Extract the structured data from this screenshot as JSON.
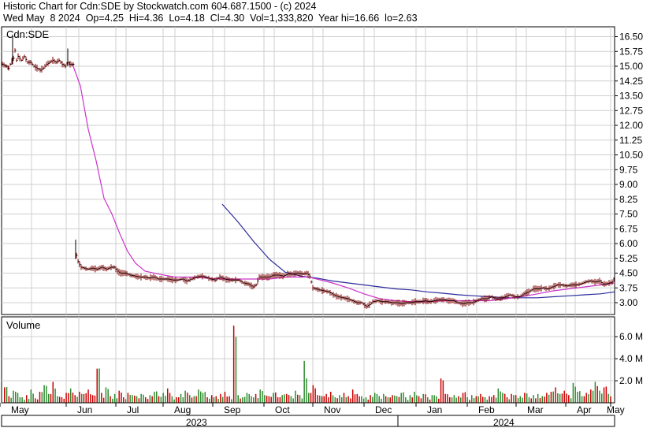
{
  "header": {
    "line1": "Historic Chart for Cdn:SDE by Stockwatch.com 604.687.1500 - (c) 2024",
    "line2": "Wed May  8 2024  Op=4.25  Hi=4.36  Lo=4.18  Cl=4.30  Vol=1,333,820  Year hi=16.66  lo=2.63"
  },
  "chart_data": [
    {
      "type": "line",
      "label": "Cdn:SDE",
      "grid": true,
      "x_axis": {
        "months": [
          "May",
          "Jun",
          "Jul",
          "Aug",
          "Sep",
          "Oct",
          "Nov",
          "Dec",
          "Jan",
          "Feb",
          "Mar",
          "Apr",
          "May"
        ],
        "years": [
          "2023",
          "2024"
        ]
      },
      "y_axis": {
        "ticks": [
          "16.50",
          "15.75",
          "15.00",
          "14.25",
          "13.50",
          "12.75",
          "12.00",
          "11.25",
          "10.50",
          "9.75",
          "9.00",
          "8.25",
          "7.50",
          "6.75",
          "6.00",
          "5.25",
          "4.50",
          "3.75",
          "3.00"
        ],
        "range": [
          2.4,
          17.0
        ]
      },
      "price_points": [
        [
          0,
          15.1
        ],
        [
          5,
          15.0
        ],
        [
          8,
          14.9
        ],
        [
          10,
          15.1
        ],
        [
          14,
          15.4
        ],
        [
          16,
          15.8
        ],
        [
          18,
          15.3
        ],
        [
          20,
          15.5
        ],
        [
          24,
          15.3
        ],
        [
          28,
          15.5
        ],
        [
          32,
          15.2
        ],
        [
          36,
          15.2
        ],
        [
          40,
          15.0
        ],
        [
          44,
          14.9
        ],
        [
          48,
          14.8
        ],
        [
          52,
          14.9
        ],
        [
          56,
          15.1
        ],
        [
          60,
          15.2
        ],
        [
          64,
          15.3
        ],
        [
          68,
          15.2
        ],
        [
          72,
          15.3
        ],
        [
          76,
          15.1
        ],
        [
          80,
          15.0
        ],
        [
          83,
          15.2
        ],
        [
          86,
          15.1
        ],
        [
          90,
          15.1
        ],
        [
          94,
          5.4
        ],
        [
          96,
          5.1
        ],
        [
          100,
          4.8
        ],
        [
          104,
          4.75
        ],
        [
          108,
          4.7
        ],
        [
          114,
          4.75
        ],
        [
          120,
          4.7
        ],
        [
          126,
          4.8
        ],
        [
          132,
          4.7
        ],
        [
          138,
          4.8
        ],
        [
          142,
          4.8
        ],
        [
          146,
          4.6
        ],
        [
          150,
          4.5
        ],
        [
          156,
          4.5
        ],
        [
          162,
          4.4
        ],
        [
          168,
          4.35
        ],
        [
          174,
          4.3
        ],
        [
          180,
          4.3
        ],
        [
          186,
          4.25
        ],
        [
          192,
          4.3
        ],
        [
          198,
          4.2
        ],
        [
          204,
          4.2
        ],
        [
          210,
          4.2
        ],
        [
          216,
          4.15
        ],
        [
          222,
          4.15
        ],
        [
          228,
          4.2
        ],
        [
          234,
          4.1
        ],
        [
          240,
          4.2
        ],
        [
          246,
          4.3
        ],
        [
          252,
          4.35
        ],
        [
          258,
          4.3
        ],
        [
          264,
          4.2
        ],
        [
          270,
          4.15
        ],
        [
          276,
          4.3
        ],
        [
          282,
          4.2
        ],
        [
          288,
          4.15
        ],
        [
          294,
          4.15
        ],
        [
          300,
          4.15
        ],
        [
          306,
          4.0
        ],
        [
          312,
          3.95
        ],
        [
          318,
          3.8
        ],
        [
          322,
          3.9
        ],
        [
          326,
          4.3
        ],
        [
          332,
          4.3
        ],
        [
          338,
          4.3
        ],
        [
          344,
          4.4
        ],
        [
          350,
          4.4
        ],
        [
          356,
          4.35
        ],
        [
          362,
          4.45
        ],
        [
          368,
          4.45
        ],
        [
          374,
          4.5
        ],
        [
          380,
          4.45
        ],
        [
          386,
          4.5
        ],
        [
          390,
          4.35
        ],
        [
          394,
          3.75
        ],
        [
          398,
          3.7
        ],
        [
          402,
          3.65
        ],
        [
          408,
          3.6
        ],
        [
          414,
          3.55
        ],
        [
          420,
          3.4
        ],
        [
          426,
          3.3
        ],
        [
          432,
          3.25
        ],
        [
          438,
          3.2
        ],
        [
          444,
          3.1
        ],
        [
          450,
          3.0
        ],
        [
          456,
          3.0
        ],
        [
          462,
          2.8
        ],
        [
          466,
          2.9
        ],
        [
          470,
          3.05
        ],
        [
          476,
          3.1
        ],
        [
          482,
          3.05
        ],
        [
          488,
          3.05
        ],
        [
          494,
          3.0
        ],
        [
          500,
          3.0
        ],
        [
          506,
          2.95
        ],
        [
          512,
          3.0
        ],
        [
          518,
          3.0
        ],
        [
          524,
          3.05
        ],
        [
          530,
          3.05
        ],
        [
          536,
          3.1
        ],
        [
          542,
          3.05
        ],
        [
          548,
          3.1
        ],
        [
          554,
          3.15
        ],
        [
          560,
          3.15
        ],
        [
          566,
          3.1
        ],
        [
          572,
          3.1
        ],
        [
          578,
          3.0
        ],
        [
          584,
          2.95
        ],
        [
          590,
          3.0
        ],
        [
          596,
          3.0
        ],
        [
          602,
          3.1
        ],
        [
          608,
          3.2
        ],
        [
          614,
          3.2
        ],
        [
          620,
          3.3
        ],
        [
          626,
          3.2
        ],
        [
          632,
          3.2
        ],
        [
          638,
          3.3
        ],
        [
          644,
          3.4
        ],
        [
          650,
          3.3
        ],
        [
          656,
          3.3
        ],
        [
          662,
          3.45
        ],
        [
          668,
          3.55
        ],
        [
          674,
          3.7
        ],
        [
          680,
          3.7
        ],
        [
          686,
          3.75
        ],
        [
          692,
          3.7
        ],
        [
          698,
          3.8
        ],
        [
          704,
          3.9
        ],
        [
          710,
          3.9
        ],
        [
          716,
          3.85
        ],
        [
          722,
          3.9
        ],
        [
          728,
          3.9
        ],
        [
          734,
          3.95
        ],
        [
          740,
          4.05
        ],
        [
          746,
          4.1
        ],
        [
          752,
          4.05
        ],
        [
          758,
          4.1
        ],
        [
          762,
          3.95
        ],
        [
          766,
          3.95
        ],
        [
          770,
          4.0
        ],
        [
          774,
          4.05
        ],
        [
          778,
          4.3
        ]
      ],
      "ma_short_points": [
        [
          90,
          15.1
        ],
        [
          100,
          14.0
        ],
        [
          110,
          11.8
        ],
        [
          120,
          10.2
        ],
        [
          130,
          8.3
        ],
        [
          140,
          7.5
        ],
        [
          150,
          6.5
        ],
        [
          160,
          5.6
        ],
        [
          170,
          5.0
        ],
        [
          182,
          4.6
        ],
        [
          200,
          4.45
        ],
        [
          220,
          4.3
        ],
        [
          240,
          4.3
        ],
        [
          260,
          4.25
        ],
        [
          280,
          4.2
        ],
        [
          300,
          4.2
        ],
        [
          320,
          4.2
        ],
        [
          340,
          4.2
        ],
        [
          360,
          4.3
        ],
        [
          380,
          4.3
        ],
        [
          390,
          4.3
        ],
        [
          400,
          4.2
        ],
        [
          420,
          4.0
        ],
        [
          440,
          3.75
        ],
        [
          460,
          3.45
        ],
        [
          480,
          3.2
        ],
        [
          500,
          3.1
        ],
        [
          520,
          3.05
        ],
        [
          540,
          3.05
        ],
        [
          560,
          3.1
        ],
        [
          580,
          3.1
        ],
        [
          600,
          3.1
        ],
        [
          620,
          3.1
        ],
        [
          640,
          3.2
        ],
        [
          660,
          3.3
        ],
        [
          680,
          3.45
        ],
        [
          700,
          3.6
        ],
        [
          720,
          3.7
        ],
        [
          740,
          3.8
        ],
        [
          760,
          3.9
        ],
        [
          778,
          4.0
        ]
      ],
      "ma_long_points": [
        [
          280,
          8.0
        ],
        [
          300,
          7.1
        ],
        [
          320,
          6.1
        ],
        [
          340,
          5.2
        ],
        [
          360,
          4.55
        ],
        [
          380,
          4.35
        ],
        [
          400,
          4.25
        ],
        [
          420,
          4.1
        ],
        [
          440,
          4.0
        ],
        [
          460,
          3.9
        ],
        [
          480,
          3.8
        ],
        [
          500,
          3.7
        ],
        [
          520,
          3.65
        ],
        [
          540,
          3.55
        ],
        [
          560,
          3.48
        ],
        [
          580,
          3.4
        ],
        [
          600,
          3.35
        ],
        [
          620,
          3.3
        ],
        [
          640,
          3.25
        ],
        [
          660,
          3.25
        ],
        [
          680,
          3.25
        ],
        [
          700,
          3.3
        ],
        [
          720,
          3.35
        ],
        [
          740,
          3.4
        ],
        [
          760,
          3.45
        ],
        [
          778,
          3.55
        ]
      ],
      "price_color": "#800000",
      "ma_short_color": "#cc33cc",
      "ma_long_color": "#2b2b9c"
    },
    {
      "type": "bar",
      "label": "Volume",
      "y_axis": {
        "ticks": [
          "6.0 M",
          "4.0 M",
          "2.0 M"
        ],
        "range": [
          0,
          7.8
        ]
      },
      "volumes_millions": [
        1.4,
        0.6,
        1.1,
        0.9,
        0.5,
        0.7,
        1.2,
        0.4,
        1.0,
        1.6,
        0.8,
        1.9,
        0.6,
        0.5,
        0.9,
        1.3,
        0.7,
        1.0,
        0.8,
        1.2,
        0.7,
        3.1,
        0.9,
        1.4,
        0.6,
        0.8,
        1.1,
        0.5,
        0.9,
        0.7,
        0.6,
        0.8,
        0.5,
        0.7,
        1.0,
        0.6,
        0.9,
        1.3,
        0.6,
        0.5,
        0.8,
        1.1,
        0.7,
        0.6,
        1.2,
        0.9,
        0.5,
        0.7,
        0.6,
        0.8,
        1.0,
        0.6,
        7.0,
        0.7,
        0.5,
        0.9,
        0.6,
        0.8,
        1.2,
        0.7,
        0.6,
        0.9,
        0.5,
        0.7,
        0.8,
        0.6,
        1.1,
        0.7,
        3.8,
        0.9,
        1.6,
        0.7,
        0.6,
        0.8,
        1.0,
        0.5,
        0.7,
        0.9,
        0.6,
        1.2,
        0.8,
        0.6,
        0.5,
        0.7,
        0.9,
        0.6,
        0.8,
        0.5,
        0.7,
        0.6,
        0.9,
        0.5,
        0.7,
        1.0,
        0.6,
        0.8,
        0.5,
        0.7,
        0.6,
        2.2,
        0.8,
        0.5,
        0.7,
        0.6,
        0.9,
        0.5,
        0.7,
        0.6,
        0.8,
        0.5,
        0.6,
        0.7,
        1.3,
        0.9,
        0.5,
        0.8,
        0.7,
        0.6,
        0.9,
        0.5,
        0.7,
        0.8,
        0.6,
        0.9,
        1.0,
        1.4,
        0.8,
        1.1,
        0.7,
        1.8,
        1.0,
        0.6,
        0.9,
        1.2,
        1.9,
        1.1,
        1.4,
        0.8
      ],
      "bar_colors_cycle": [
        "#cc0000",
        "#2e8b2e"
      ]
    }
  ]
}
